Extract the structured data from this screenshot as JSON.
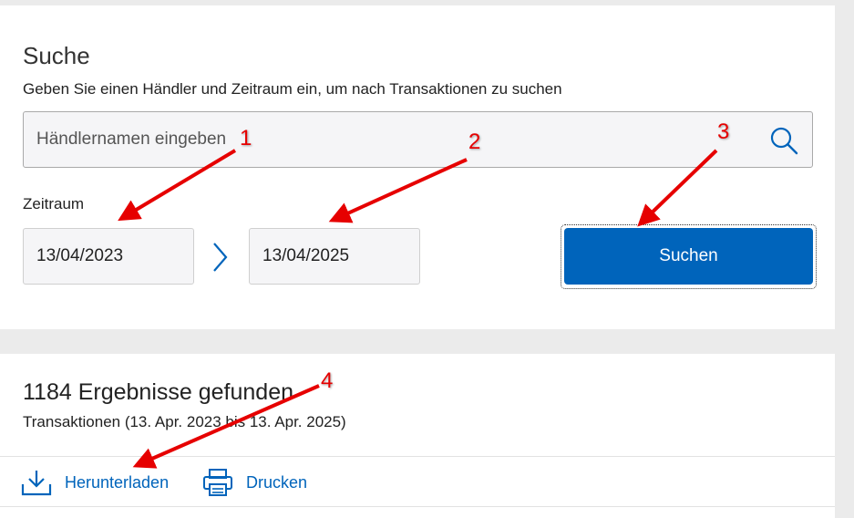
{
  "search": {
    "title": "Suche",
    "subtitle": "Geben Sie einen Händler und Zeitraum ein, um nach Transaktionen zu suchen",
    "merchant_placeholder": "Händlernamen eingeben",
    "range_label": "Zeitraum",
    "date_from": "13/04/2023",
    "date_to": "13/04/2025",
    "button_label": "Suchen"
  },
  "results": {
    "title": "1184 Ergebnisse gefunden",
    "subtitle": "Transaktionen (13. Apr. 2023 bis 13. Apr. 2025)",
    "actions": [
      {
        "label": "Herunterladen",
        "icon": "download-icon"
      },
      {
        "label": "Drucken",
        "icon": "printer-icon"
      }
    ]
  },
  "annotations": {
    "markers": [
      "1",
      "2",
      "3",
      "4"
    ],
    "color": "#e60000"
  },
  "colors": {
    "accent": "#0064bb",
    "background": "#ebebeb"
  }
}
